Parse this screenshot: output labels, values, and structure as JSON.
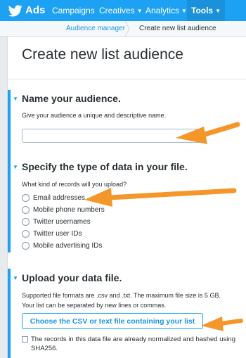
{
  "nav": {
    "brand": "Ads",
    "items": [
      {
        "label": "Campaigns",
        "has_menu": false
      },
      {
        "label": "Creatives",
        "has_menu": true
      },
      {
        "label": "Analytics",
        "has_menu": true
      },
      {
        "label": "Tools",
        "has_menu": true
      }
    ]
  },
  "breadcrumb": {
    "parent": "Audience manager",
    "current": "Create new list audience"
  },
  "page": {
    "title": "Create new list audience"
  },
  "sections": {
    "name": {
      "heading": "Name your audience.",
      "description": "Give your audience a unique and descriptive name.",
      "input_value": ""
    },
    "type": {
      "heading": "Specify the type of data in your file.",
      "question": "What kind of records will you upload?",
      "options": [
        "Email addresses",
        "Mobile phone numbers",
        "Twitter usernames",
        "Twitter user IDs",
        "Mobile advertising IDs"
      ]
    },
    "upload": {
      "heading": "Upload your data file.",
      "description_line1": "Supported file formats are .csv and .txt. The maximum file size is 5 GB.",
      "description_line2": "Your list can be separated by new lines or commas.",
      "button_label": "Choose the CSV or text file containing your list",
      "checkbox_label": "The records in this data file are already normalized and hashed using SHA256."
    }
  },
  "colors": {
    "brand": "#1da1f2",
    "annotation_arrow": "#f5962a"
  },
  "icons": [
    "twitter-bird-icon",
    "chevron-down-icon",
    "breadcrumb-separator-icon",
    "section-caret-icon",
    "arrow-annotation"
  ]
}
